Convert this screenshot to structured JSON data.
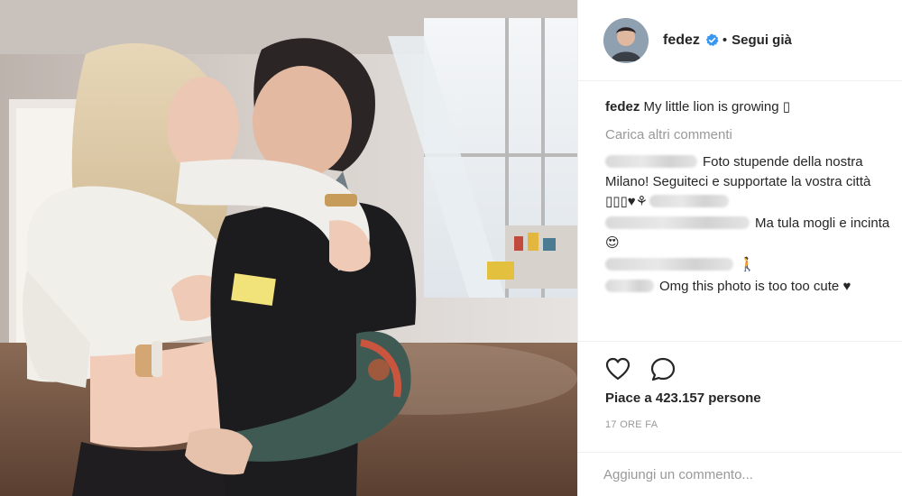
{
  "post": {
    "image_description_icon": "photo",
    "author": {
      "username": "fedez",
      "verified_icon": "verified-badge-icon",
      "separator": "•",
      "follow_status": "Segui già"
    },
    "caption": {
      "username": "fedez",
      "text": "My little lion is growing ▯"
    },
    "load_more_label": "Carica altri commenti",
    "comments": [
      {
        "text": "Foto stupende della nostra Milano! Seguiteci e supportate la vostra città ▯▯▯♥⚘"
      },
      {
        "text": "Ma tula mogli e incinta😍"
      },
      {
        "text": "🚶"
      },
      {
        "text": "Omg this photo is too too cute ♥"
      }
    ],
    "actions": {
      "like_icon": "heart-outline-icon",
      "comment_icon": "comment-bubble-icon"
    },
    "likes_label": "Piace a 423.157 persone",
    "timestamp": "17 ORE FA",
    "comment_input_placeholder": "Aggiungi un commento..."
  },
  "colors": {
    "text": "#262626",
    "secondary": "#999999",
    "verified": "#3897f0",
    "border": "#efefef"
  }
}
